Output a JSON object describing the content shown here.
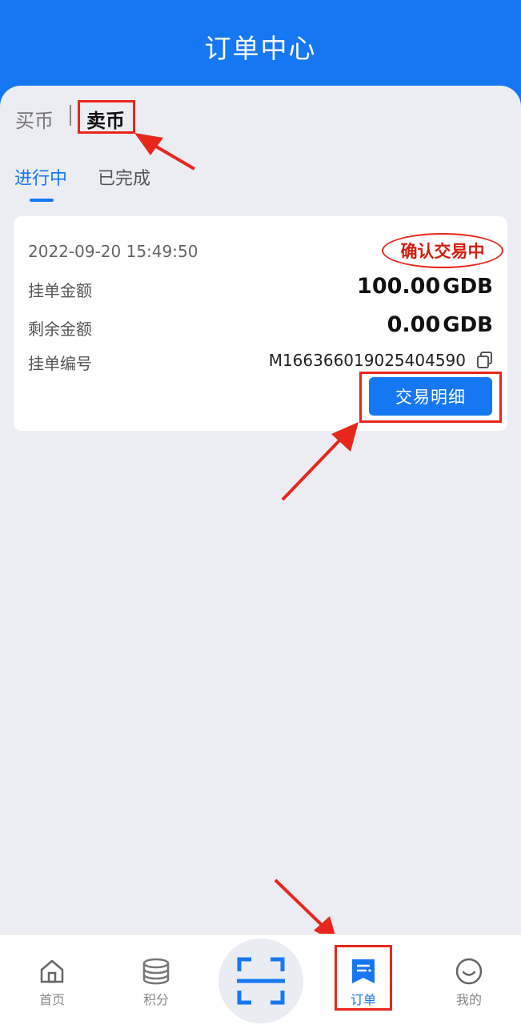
{
  "header": {
    "title": "订单中心"
  },
  "segment": {
    "buy_label": "买币",
    "sell_label": "卖币",
    "active": "sell"
  },
  "tabs": [
    {
      "label": "进行中",
      "active": true
    },
    {
      "label": "已完成",
      "active": false
    }
  ],
  "order": {
    "time": "2022-09-20 15:49:50",
    "status": "确认交易中",
    "amount_label": "挂单金额",
    "amount_value": "100.00",
    "amount_unit": "GDB",
    "remaining_label": "剩余金额",
    "remaining_value": "0.00",
    "remaining_unit": "GDB",
    "order_no_label": "挂单编号",
    "order_no": "M166366019025404590",
    "detail_button": "交易明细"
  },
  "tabbar": {
    "items": [
      {
        "label": "首页",
        "icon": "home-icon",
        "active": false
      },
      {
        "label": "积分",
        "icon": "coins-icon",
        "active": false
      },
      {
        "label": "",
        "icon": "scan-icon",
        "active": false
      },
      {
        "label": "订单",
        "icon": "order-icon",
        "active": true
      },
      {
        "label": "我的",
        "icon": "smile-icon",
        "active": false
      }
    ]
  },
  "colors": {
    "primary": "#1677f2",
    "annotation": "#e8271c",
    "background": "#ebedf3"
  }
}
